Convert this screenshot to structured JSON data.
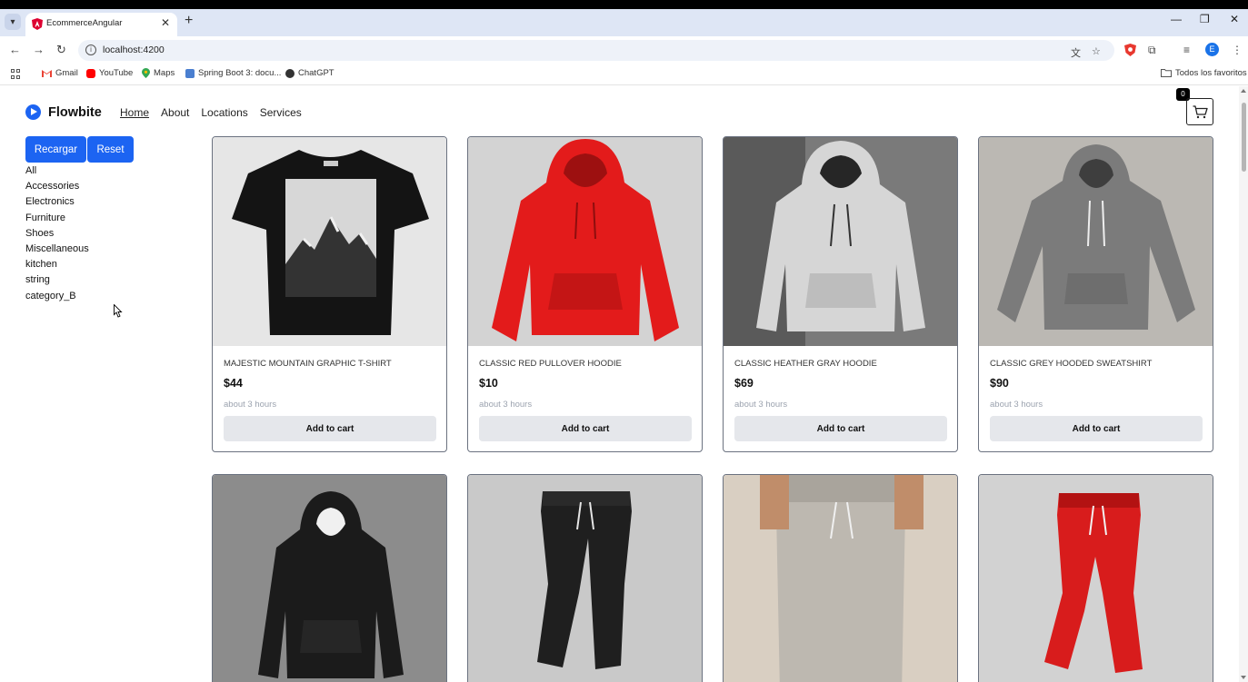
{
  "browser": {
    "tab_title": "EcommerceAngular",
    "url": "localhost:4200",
    "bookmarks": [
      "Gmail",
      "YouTube",
      "Maps",
      "Spring Boot 3: docu...",
      "ChatGPT"
    ],
    "all_bookmarks": "Todos los favoritos",
    "profile_initial": "E"
  },
  "header": {
    "brand": "Flowbite",
    "nav": [
      "Home",
      "About",
      "Locations",
      "Services"
    ],
    "cart_count": "0"
  },
  "sidebar": {
    "reload_label": "Recargar",
    "reset_label": "Reset",
    "categories": [
      "All",
      "Accessories",
      "Electronics",
      "Furniture",
      "Shoes",
      "Miscellaneous",
      "kitchen",
      "string",
      "category_B"
    ]
  },
  "products": [
    {
      "title": "Majestic Mountain Graphic T-Shirt",
      "price": "$44",
      "time": "about 3 hours",
      "button": "Add to cart",
      "image": "black-tshirt-mountain"
    },
    {
      "title": "Classic Red Pullover Hoodie",
      "price": "$10",
      "time": "about 3 hours",
      "button": "Add to cart",
      "image": "red-hoodie"
    },
    {
      "title": "Classic Heather Gray Hoodie",
      "price": "$69",
      "time": "about 3 hours",
      "button": "Add to cart",
      "image": "gray-hoodie"
    },
    {
      "title": "Classic Grey Hooded Sweatshirt",
      "price": "$90",
      "time": "about 3 hours",
      "button": "Add to cart",
      "image": "grey-sweatshirt"
    },
    {
      "image": "black-hoodie"
    },
    {
      "image": "black-joggers"
    },
    {
      "image": "light-gray-joggers"
    },
    {
      "image": "red-joggers"
    }
  ],
  "colors": {
    "accent": "#1c64f2",
    "tabstrip": "#dee6f5"
  }
}
